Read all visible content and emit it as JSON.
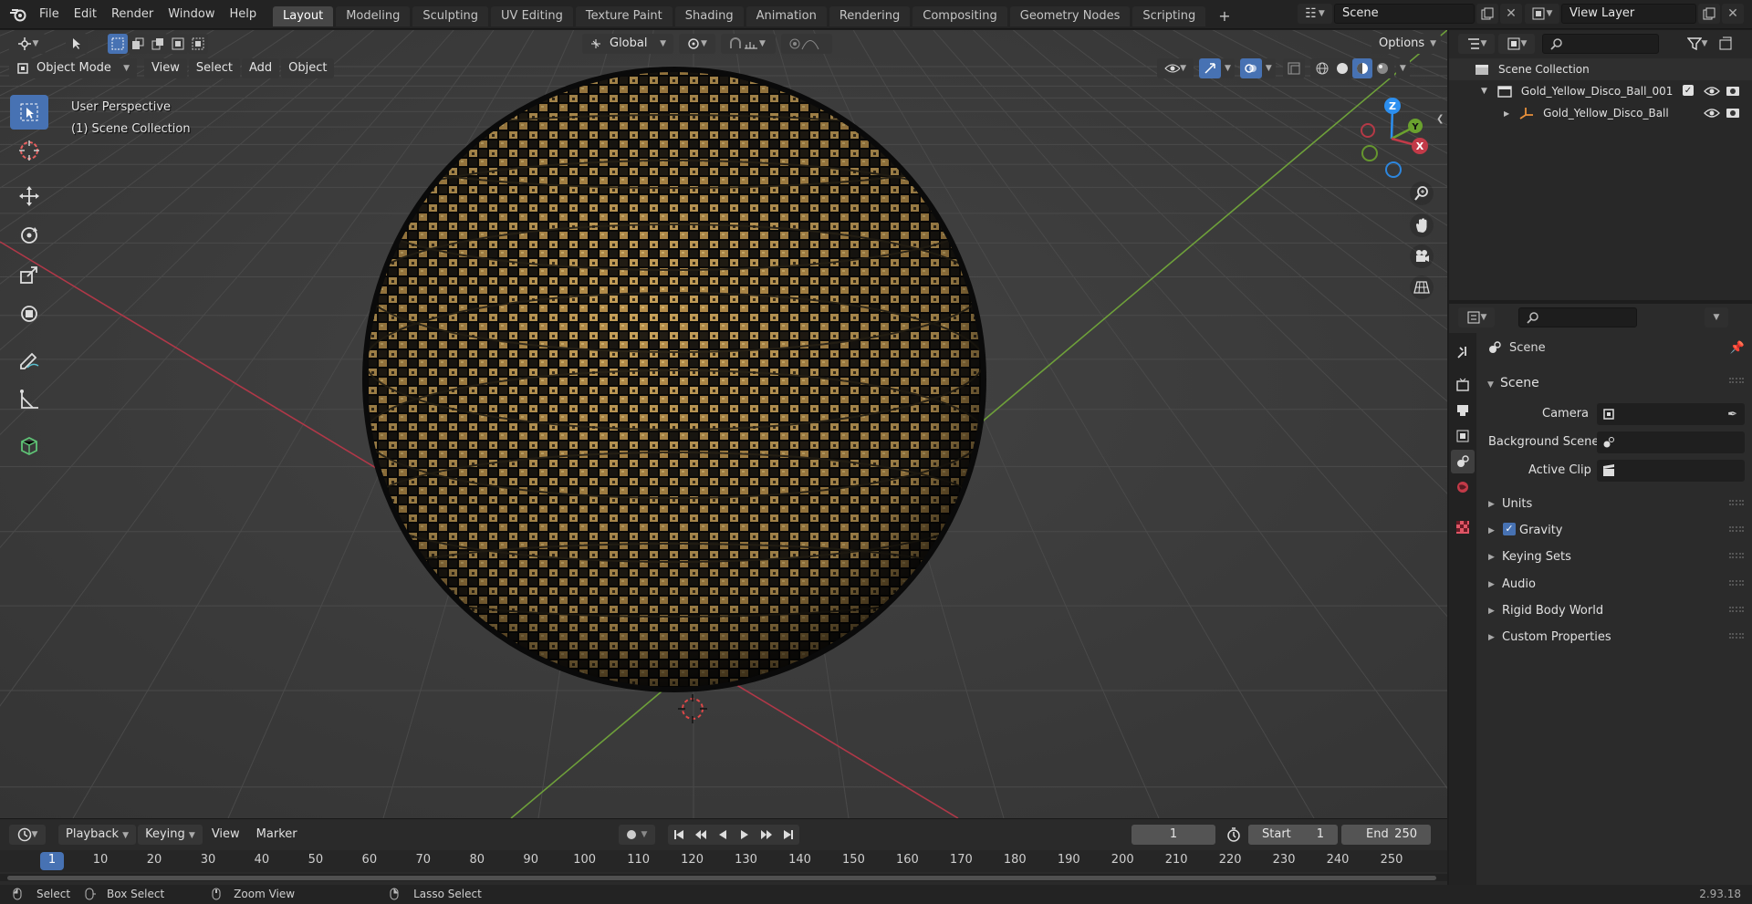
{
  "topbar": {
    "menus": [
      "File",
      "Edit",
      "Render",
      "Window",
      "Help"
    ],
    "workspaces": [
      "Layout",
      "Modeling",
      "Sculpting",
      "UV Editing",
      "Texture Paint",
      "Shading",
      "Animation",
      "Rendering",
      "Compositing",
      "Geometry Nodes",
      "Scripting"
    ],
    "add_tab": "+",
    "scene": "Scene",
    "view_layer": "View Layer"
  },
  "viewport": {
    "transform_orientation": "Global",
    "options": "Options",
    "mode": "Object Mode",
    "menus": [
      "View",
      "Select",
      "Add",
      "Object"
    ],
    "overlay_line1": "User Perspective",
    "overlay_line2": "(1) Scene Collection",
    "gizmo": {
      "z": "Z",
      "y": "Y",
      "x": "X"
    }
  },
  "timeline": {
    "menus": [
      "Playback",
      "Keying",
      "View",
      "Marker"
    ],
    "current_frame": "1",
    "start_label": "Start",
    "start": "1",
    "end_label": "End",
    "end": "250",
    "ruler": [
      "1",
      "10",
      "20",
      "30",
      "40",
      "50",
      "60",
      "70",
      "80",
      "90",
      "100",
      "110",
      "120",
      "130",
      "140",
      "150",
      "160",
      "170",
      "180",
      "190",
      "200",
      "210",
      "220",
      "230",
      "240",
      "250"
    ]
  },
  "statusbar": {
    "select": "Select",
    "box_select": "Box Select",
    "zoom_view": "Zoom View",
    "lasso_select": "Lasso Select",
    "version": "2.93.18"
  },
  "outliner": {
    "root": "Scene Collection",
    "collection": "Gold_Yellow_Disco_Ball_001",
    "object": "Gold_Yellow_Disco_Ball"
  },
  "properties": {
    "context": "Scene",
    "panel": "Scene",
    "camera_label": "Camera",
    "bg_scene_label": "Background Scene",
    "active_clip_label": "Active Clip",
    "subpanels": [
      "Units",
      "Gravity",
      "Keying Sets",
      "Audio",
      "Rigid Body World",
      "Custom Properties"
    ]
  },
  "colors": {
    "accent": "#4772b3",
    "x_axis": "#c23a48",
    "y_axis": "#6aa12e",
    "z_axis": "#2c8ff0",
    "gold": "#c9a25a"
  }
}
